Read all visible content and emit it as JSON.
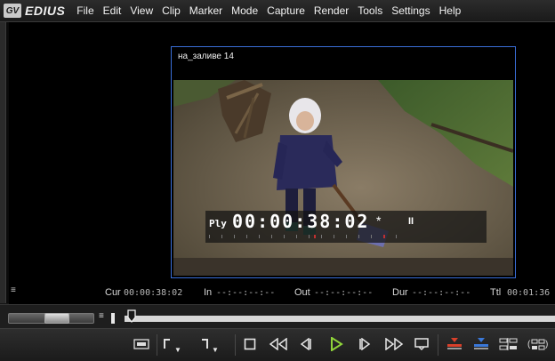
{
  "app": {
    "logo_text": "GV",
    "brand": "EDIUS"
  },
  "menu": [
    "File",
    "Edit",
    "View",
    "Clip",
    "Marker",
    "Mode",
    "Capture",
    "Render",
    "Tools",
    "Settings",
    "Help"
  ],
  "monitor": {
    "clip_name": "на_заливе 14",
    "osd": {
      "mode": "Ply",
      "timecode": "00:00:38:02",
      "indicator": "*",
      "pause_glyph": "II"
    }
  },
  "info_row": {
    "cur_label": "Cur",
    "cur_value": "00:00:38:02",
    "in_label": "In",
    "in_value": "--:--:--:--",
    "out_label": "Out",
    "out_value": "--:--:--:--",
    "dur_label": "Dur",
    "dur_value": "--:--:--:--",
    "ttl_label": "Ttl",
    "ttl_value": "00:01:36"
  },
  "colors": {
    "frame_border": "#3a6ed8",
    "play_icon": "#8fd43a",
    "accent_red": "#d8402a",
    "accent_blue": "#3a78d8"
  },
  "transport": {
    "buttons": [
      "clip-icon",
      "set-in-icon",
      "set-out-icon",
      "stop-icon",
      "rewind-icon",
      "step-back-icon",
      "play-icon",
      "step-forward-icon",
      "fast-forward-icon",
      "play-around-icon",
      "insert-to-timeline-icon",
      "overwrite-to-timeline-icon",
      "add-marker-icon",
      "options-icon"
    ]
  }
}
